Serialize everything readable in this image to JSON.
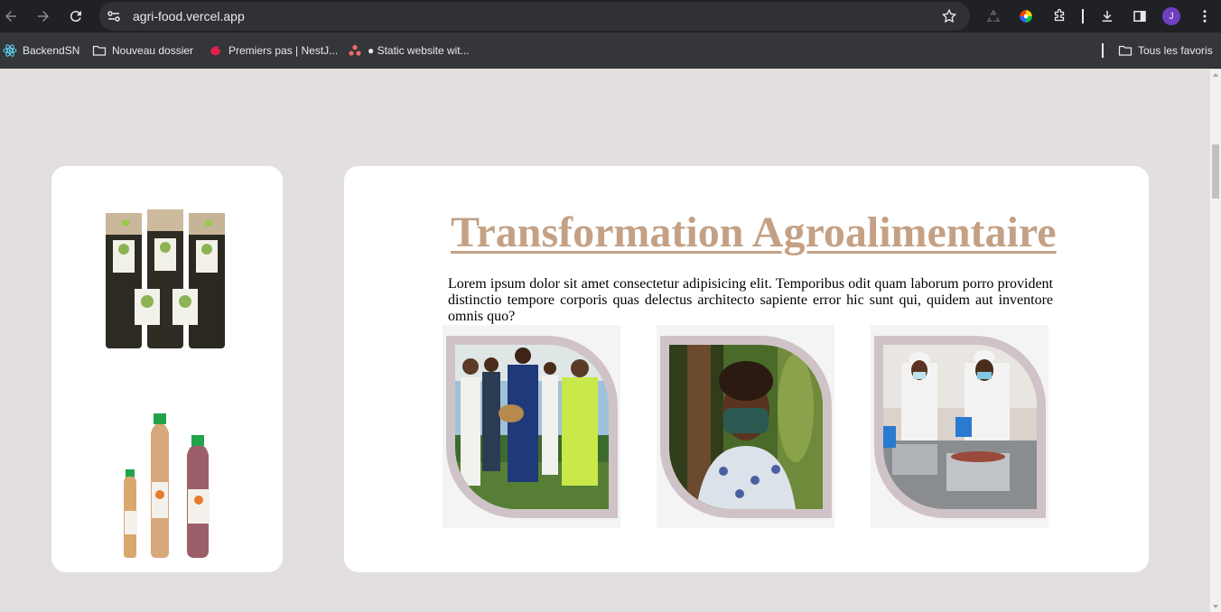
{
  "browser": {
    "url": "agri-food.vercel.app",
    "avatar_initial": "J",
    "bookmarks": [
      {
        "label": "BackendSN",
        "icon": "react-icon"
      },
      {
        "label": "Nouveau dossier",
        "icon": "folder-icon"
      },
      {
        "label": "Premiers pas | NestJ...",
        "icon": "nestjs-icon"
      },
      {
        "label": "● Static website wit...",
        "icon": "asana-icon"
      }
    ],
    "all_bookmarks_label": "Tous les favoris"
  },
  "section": {
    "title": "Transformation Agroalimentaire",
    "paragraph": "Lorem ipsum dolor sit amet consectetur adipisicing elit. Temporibus odit quam laborum porro provident distinctio tempore corporis quas delectus architecto sapiente error hic sunt qui, quidem aut inventore omnis quo?",
    "photos": [
      {
        "subject": "farmers-in-field-photo"
      },
      {
        "subject": "woman-with-mask-photo"
      },
      {
        "subject": "food-processing-workers-photo"
      }
    ]
  },
  "products": [
    {
      "subject": "packaged-tea-bags-image"
    },
    {
      "subject": "juice-bottles-image"
    }
  ],
  "colors": {
    "title": "#c4a185",
    "page_bg": "#e4dfdf",
    "frame_border": "#cfc3c7"
  }
}
